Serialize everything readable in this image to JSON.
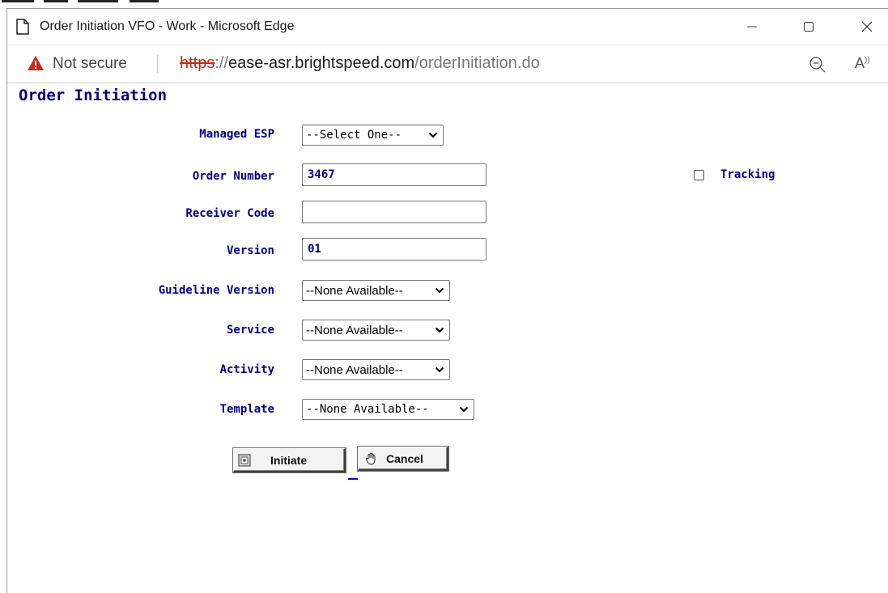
{
  "window": {
    "title": "Order Initiation VFO - Work - Microsoft Edge"
  },
  "addressbar": {
    "security_label": "Not secure",
    "url_protocol": "https",
    "url_separator": "://",
    "url_host": "ease-asr.brightspeed.com",
    "url_path": "/orderInitiation.do"
  },
  "page": {
    "heading": "Order Initiation"
  },
  "form": {
    "managed_esp": {
      "label": "Managed ESP",
      "value": "--Select One--"
    },
    "order_number": {
      "label": "Order Number",
      "value": "3467"
    },
    "tracking": {
      "label": "Tracking",
      "checked": false
    },
    "receiver_code": {
      "label": "Receiver Code",
      "value": ""
    },
    "version": {
      "label": "Version",
      "value": "01"
    },
    "guideline_version": {
      "label": "Guideline Version",
      "value": "--None Available--"
    },
    "service": {
      "label": "Service",
      "value": "--None Available--"
    },
    "activity": {
      "label": "Activity",
      "value": "--None Available--"
    },
    "template": {
      "label": "Template",
      "value": "--None Available--"
    }
  },
  "buttons": {
    "initiate": "Initiate",
    "cancel": "Cancel"
  },
  "colors": {
    "label": "#000080",
    "warning": "#c42b1c"
  },
  "icons": {
    "page": "page-icon",
    "minimize": "minimize-icon",
    "maximize": "maximize-icon",
    "close": "close-icon",
    "warning": "warning-icon",
    "zoom": "zoom-out-icon",
    "read_aloud": "read-aloud-icon",
    "initiate": "document-icon",
    "cancel": "hand-icon"
  }
}
